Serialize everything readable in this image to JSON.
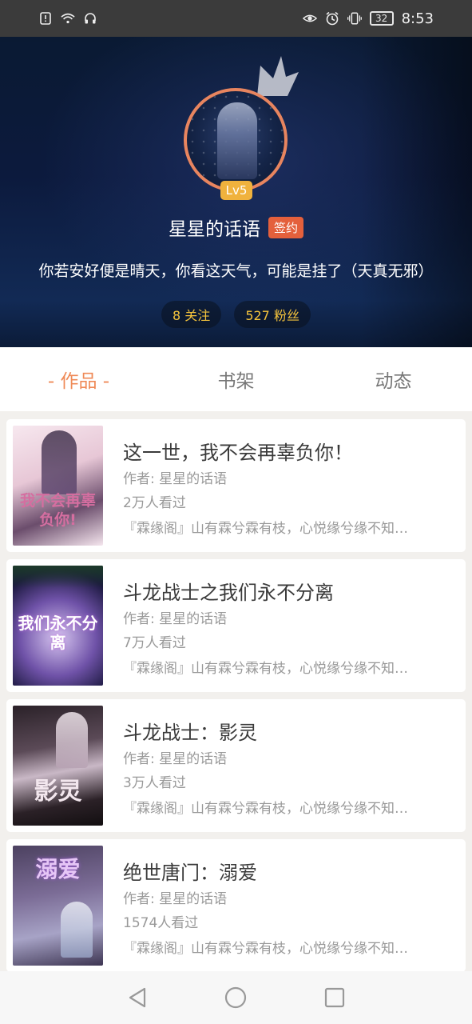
{
  "status_bar": {
    "left_icons": [
      "alert-icon",
      "wifi-icon",
      "headphones-icon"
    ],
    "right_icons": [
      "eye-icon",
      "alarm-icon",
      "vibrate-icon"
    ],
    "battery": "32",
    "time": "8:53"
  },
  "profile": {
    "level": "Lv5",
    "username": "星星的话语",
    "sign_badge": "签约",
    "bio": "你若安好便是晴天，你看这天气，可能是挂了（天真无邪）",
    "following": "8 关注",
    "followers": "527 粉丝"
  },
  "tabs": [
    {
      "label": "- 作品 -",
      "active": true
    },
    {
      "label": "书架",
      "active": false
    },
    {
      "label": "动态",
      "active": false
    }
  ],
  "books": [
    {
      "title": "这一世，我不会再辜负你！",
      "author": "作者: 星星的话语",
      "views": "2万人看过",
      "desc": "『霖缘阁』山有霖兮霖有枝，心悦缘兮缘不知…",
      "cover_text": "我不会再辜负你!"
    },
    {
      "title": "斗龙战士之我们永不分离",
      "author": "作者: 星星的话语",
      "views": "7万人看过",
      "desc": "『霖缘阁』山有霖兮霖有枝，心悦缘兮缘不知…",
      "cover_text": "我们永不分离"
    },
    {
      "title": "斗龙战士：影灵",
      "author": "作者: 星星的话语",
      "views": "3万人看过",
      "desc": "『霖缘阁』山有霖兮霖有枝，心悦缘兮缘不知…",
      "cover_text": "影灵"
    },
    {
      "title": "绝世唐门：溺爱",
      "author": "作者: 星星的话语",
      "views": "1574人看过",
      "desc": "『霖缘阁』山有霖兮霖有枝，心悦缘兮缘不知…",
      "cover_text": "溺爱"
    }
  ],
  "nav": [
    "back-icon",
    "home-icon",
    "recents-icon"
  ],
  "colors": {
    "accent": "#ef8a57",
    "avatar_ring": "#e8855f",
    "level_badge": "#f0b23d",
    "sign_badge": "#e4603c",
    "stat_text": "#f3c23c"
  }
}
